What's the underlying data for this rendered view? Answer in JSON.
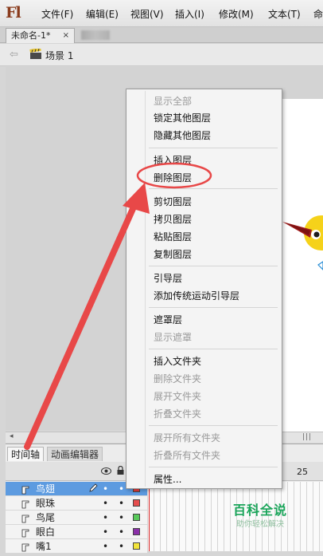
{
  "app": {
    "logo": "Fl"
  },
  "menubar": {
    "items": [
      "文件(F)",
      "编辑(E)",
      "视图(V)",
      "插入(I)",
      "修改(M)",
      "文本(T)",
      "命"
    ]
  },
  "document_tab": {
    "label": "未命名-1*",
    "close": "×"
  },
  "scene": {
    "label": "场景 1",
    "back_icon": "back-arrow-icon"
  },
  "context_menu": {
    "items": [
      {
        "label": "显示全部",
        "enabled": false
      },
      {
        "label": "锁定其他图层",
        "enabled": true
      },
      {
        "label": "隐藏其他图层",
        "enabled": true
      },
      {
        "label": "插入图层",
        "enabled": true
      },
      {
        "label": "删除图层",
        "enabled": true,
        "highlighted": true
      },
      {
        "label": "剪切图层",
        "enabled": true
      },
      {
        "label": "拷贝图层",
        "enabled": true
      },
      {
        "label": "粘贴图层",
        "enabled": true
      },
      {
        "label": "复制图层",
        "enabled": true
      },
      {
        "label": "引导层",
        "enabled": true
      },
      {
        "label": "添加传统运动引导层",
        "enabled": true
      },
      {
        "label": "遮罩层",
        "enabled": true
      },
      {
        "label": "显示遮罩",
        "enabled": false
      },
      {
        "label": "插入文件夹",
        "enabled": true
      },
      {
        "label": "删除文件夹",
        "enabled": false
      },
      {
        "label": "展开文件夹",
        "enabled": false
      },
      {
        "label": "折叠文件夹",
        "enabled": false
      },
      {
        "label": "展开所有文件夹",
        "enabled": false
      },
      {
        "label": "折叠所有文件夹",
        "enabled": false
      },
      {
        "label": "属性...",
        "enabled": true
      }
    ]
  },
  "timeline": {
    "tabs": [
      "时间轴",
      "动画编辑器"
    ],
    "frame_marker": "25",
    "layers": [
      {
        "name": "鸟翅",
        "selected": true,
        "color": "#e23b3b"
      },
      {
        "name": "眼珠",
        "selected": false,
        "color": "#e64d4d"
      },
      {
        "name": "鸟尾",
        "selected": false,
        "color": "#58c95a"
      },
      {
        "name": "眼白",
        "selected": false,
        "color": "#8a2fa8"
      },
      {
        "name": "嘴1",
        "selected": false,
        "color": "#f2e43a"
      }
    ],
    "dot": "•"
  },
  "watermark": {
    "title": "百科全说",
    "subtitle": "助你轻松解决"
  },
  "colors": {
    "annotation_red": "#e84848",
    "selection_blue": "#5d9be0",
    "bird_yellow": "#f5d21a",
    "bird_red": "#a51f1f",
    "watermark_green": "#1aa55a"
  }
}
